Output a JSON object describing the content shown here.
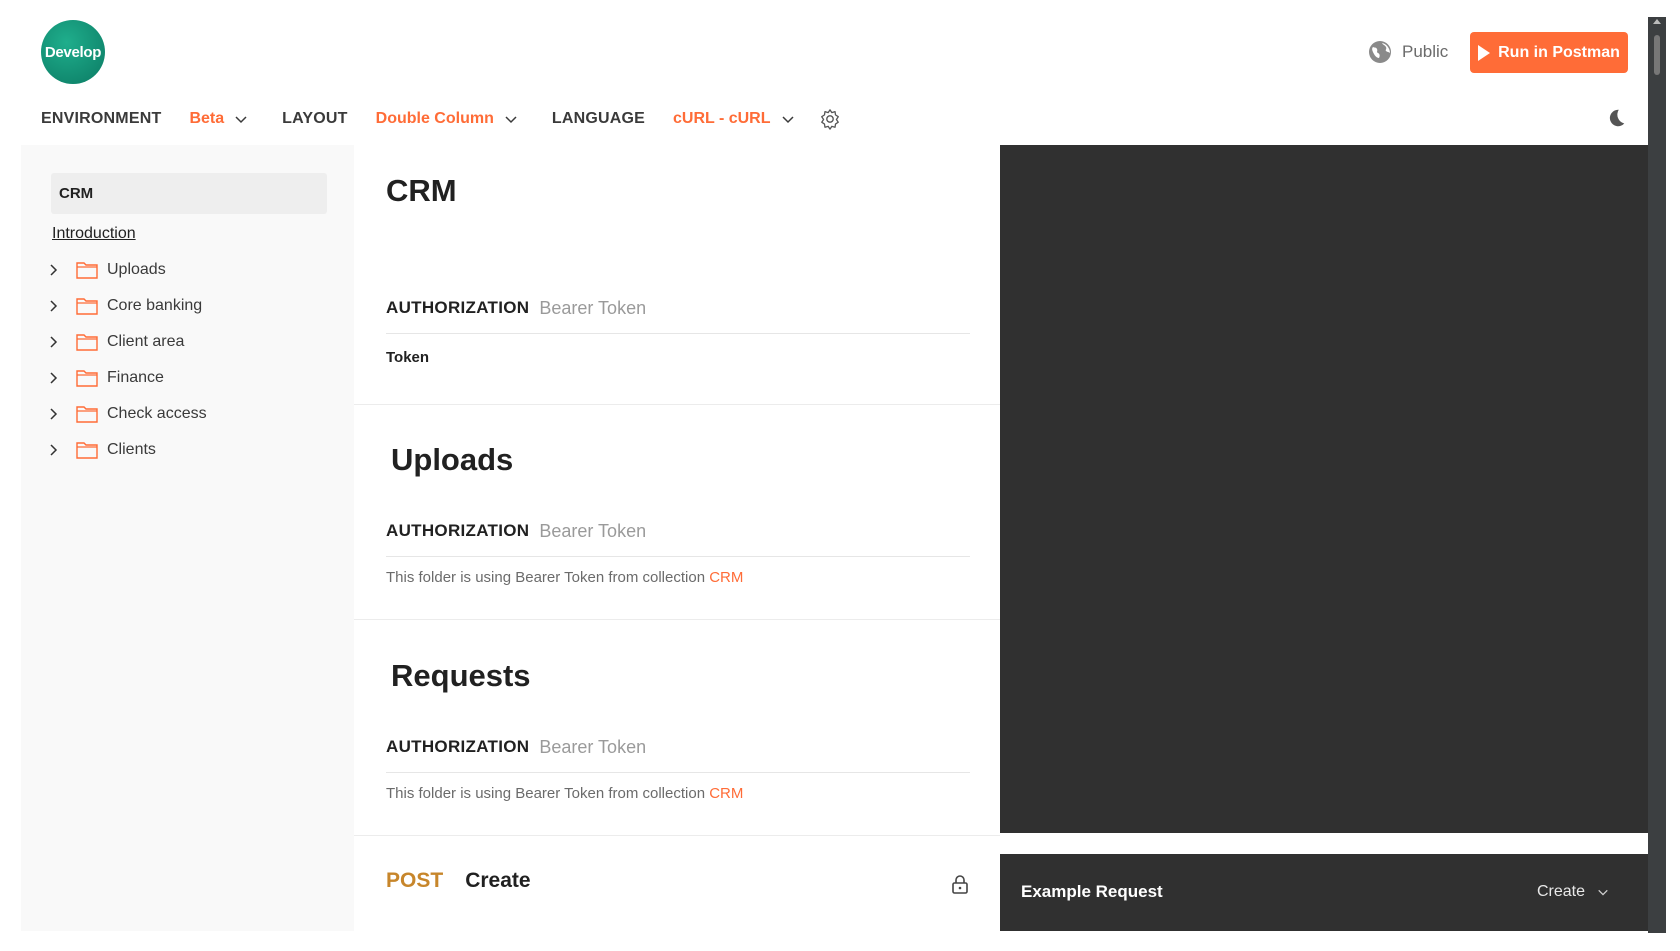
{
  "header": {
    "logo_text": "Develop",
    "visibility_label": "Public",
    "run_button_label": "Run in Postman"
  },
  "toolbar": {
    "environment_label": "ENVIRONMENT",
    "environment_value": "Beta",
    "layout_label": "LAYOUT",
    "layout_value": "Double Column",
    "language_label": "LANGUAGE",
    "language_value": "cURL - cURL"
  },
  "sidebar": {
    "collection": "CRM",
    "introduction": "Introduction",
    "folders": [
      "Uploads",
      "Core banking",
      "Client area",
      "Finance",
      "Check access",
      "Clients"
    ]
  },
  "main": {
    "collection_title": "CRM",
    "collection_auth": {
      "title": "AUTHORIZATION",
      "type": "Bearer Token",
      "field": "Token"
    },
    "uploads": {
      "title": "Uploads",
      "auth_title": "AUTHORIZATION",
      "auth_type": "Bearer Token",
      "note": "This folder is using Bearer Token from collection ",
      "note_link": "CRM"
    },
    "requests": {
      "title": "Requests",
      "auth_title": "AUTHORIZATION",
      "auth_type": "Bearer Token",
      "note": "This folder is using Bearer Token from collection ",
      "note_link": "CRM"
    },
    "request": {
      "method": "POST",
      "name": "Create"
    }
  },
  "example": {
    "title": "Example Request",
    "selected": "Create"
  },
  "colors": {
    "accent": "#ff6c37",
    "dark_pane": "#303030",
    "method_post": "#c7862b"
  }
}
